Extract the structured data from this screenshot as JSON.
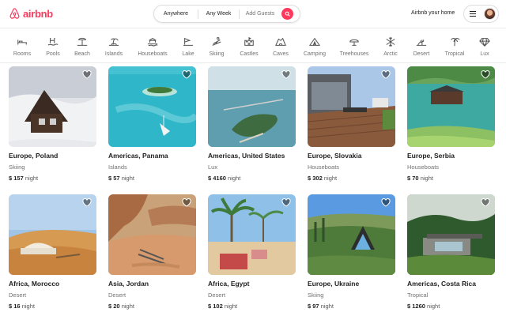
{
  "header": {
    "brand": "airbnb",
    "brand_color": "#ff385c",
    "search": {
      "anywhere": "Anywhere",
      "week": "Any Week",
      "guests": "Add Guests"
    },
    "host_link": "Airbnb your home"
  },
  "categories": [
    {
      "label": "Rooms",
      "icon": "bed-icon"
    },
    {
      "label": "Pools",
      "icon": "pool-icon"
    },
    {
      "label": "Beach",
      "icon": "beach-icon"
    },
    {
      "label": "Islands",
      "icon": "island-icon"
    },
    {
      "label": "Houseboats",
      "icon": "houseboat-icon"
    },
    {
      "label": "Lake",
      "icon": "lake-icon"
    },
    {
      "label": "Skiing",
      "icon": "skiing-icon"
    },
    {
      "label": "Castles",
      "icon": "castle-icon"
    },
    {
      "label": "Caves",
      "icon": "cave-icon"
    },
    {
      "label": "Camping",
      "icon": "tent-icon"
    },
    {
      "label": "Treehouses",
      "icon": "treehouse-icon"
    },
    {
      "label": "Arctic",
      "icon": "snowflake-icon"
    },
    {
      "label": "Desert",
      "icon": "desert-icon"
    },
    {
      "label": "Tropical",
      "icon": "palm-icon"
    },
    {
      "label": "Lux",
      "icon": "diamond-icon"
    }
  ],
  "listings": [
    {
      "location": "Europe, Poland",
      "category": "Skiing",
      "price": "$ 157",
      "unit": "night",
      "scene": "snow-cabin"
    },
    {
      "location": "Americas, Panama",
      "category": "Islands",
      "price": "$ 57",
      "unit": "night",
      "scene": "tropical-island"
    },
    {
      "location": "Americas, United States",
      "category": "Lux",
      "price": "$ 4160",
      "unit": "night",
      "scene": "island-aerial"
    },
    {
      "location": "Europe, Slovakia",
      "category": "Houseboats",
      "price": "$ 302",
      "unit": "night",
      "scene": "deck"
    },
    {
      "location": "Europe, Serbia",
      "category": "Houseboats",
      "price": "$ 70",
      "unit": "night",
      "scene": "lake-cabin"
    },
    {
      "location": "Africa, Morocco",
      "category": "Desert",
      "price": "$ 16",
      "unit": "night",
      "scene": "desert-tent"
    },
    {
      "location": "Asia, Jordan",
      "category": "Desert",
      "price": "$ 20",
      "unit": "night",
      "scene": "desert-canyon"
    },
    {
      "location": "Africa, Egypt",
      "category": "Desert",
      "price": "$ 102",
      "unit": "night",
      "scene": "palm-terrace"
    },
    {
      "location": "Europe, Ukraine",
      "category": "Skiing",
      "price": "$ 97",
      "unit": "night",
      "scene": "a-frame"
    },
    {
      "location": "Americas, Costa Rica",
      "category": "Tropical",
      "price": "$ 1260",
      "unit": "night",
      "scene": "jungle-house"
    }
  ]
}
